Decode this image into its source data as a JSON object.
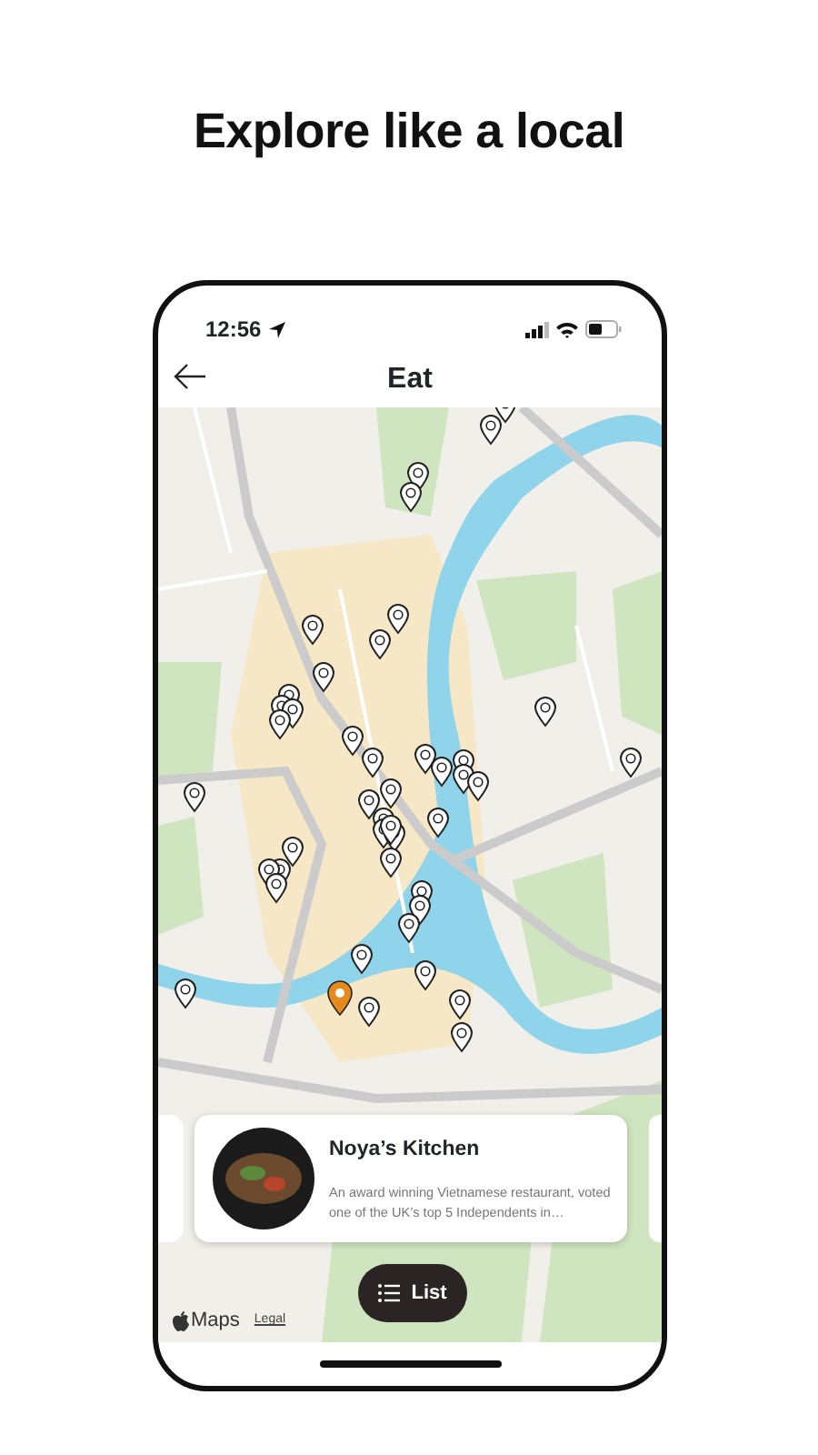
{
  "headline": "Explore like a local",
  "status_bar": {
    "time": "12:56"
  },
  "nav": {
    "title": "Eat"
  },
  "map": {
    "attribution": "Maps",
    "legal": "Legal"
  },
  "place_card": {
    "name": "Noya’s Kitchen",
    "description": "An award winning Vietnamese restaurant, voted one of the UK’s top 5 Independents in…"
  },
  "list_button": {
    "label": "List"
  }
}
